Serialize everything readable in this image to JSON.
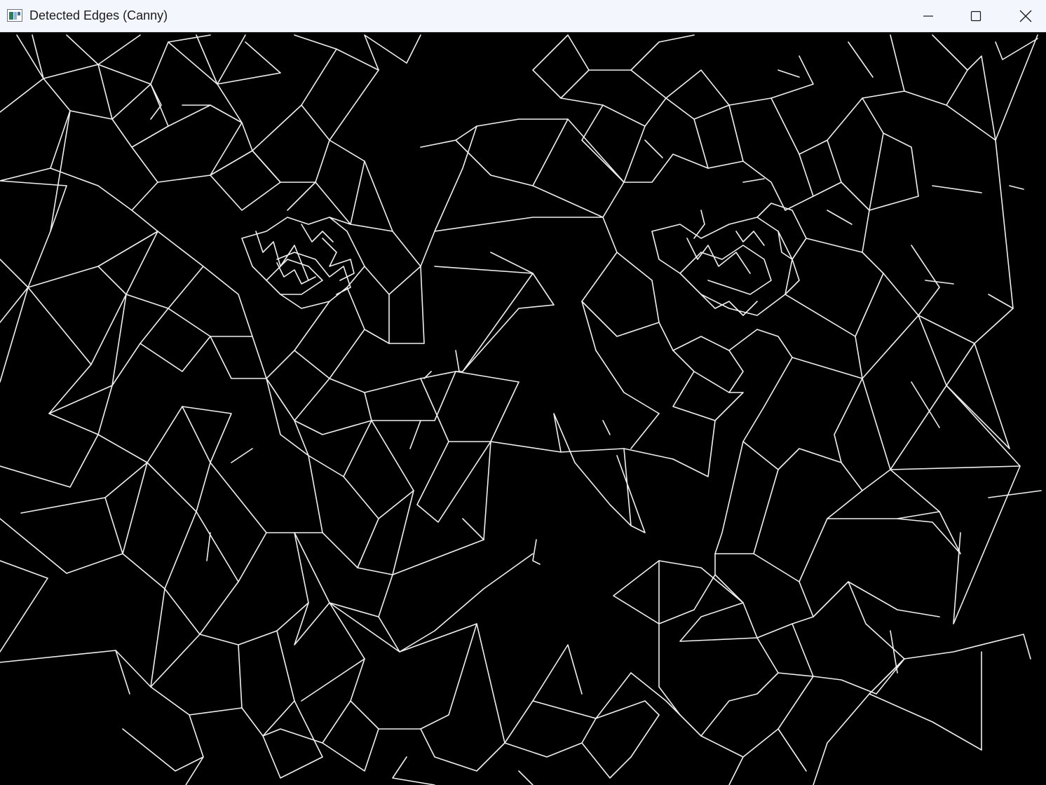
{
  "window": {
    "title": "Detected Edges (Canny)",
    "icon": "opencv-window-icon",
    "controls": {
      "minimize": "minimize-icon",
      "maximize": "maximize-icon",
      "close": "close-icon"
    }
  },
  "image": {
    "description_kind": "binary edge map",
    "background_color": "#000000",
    "edge_color": "#f0f0f0"
  }
}
